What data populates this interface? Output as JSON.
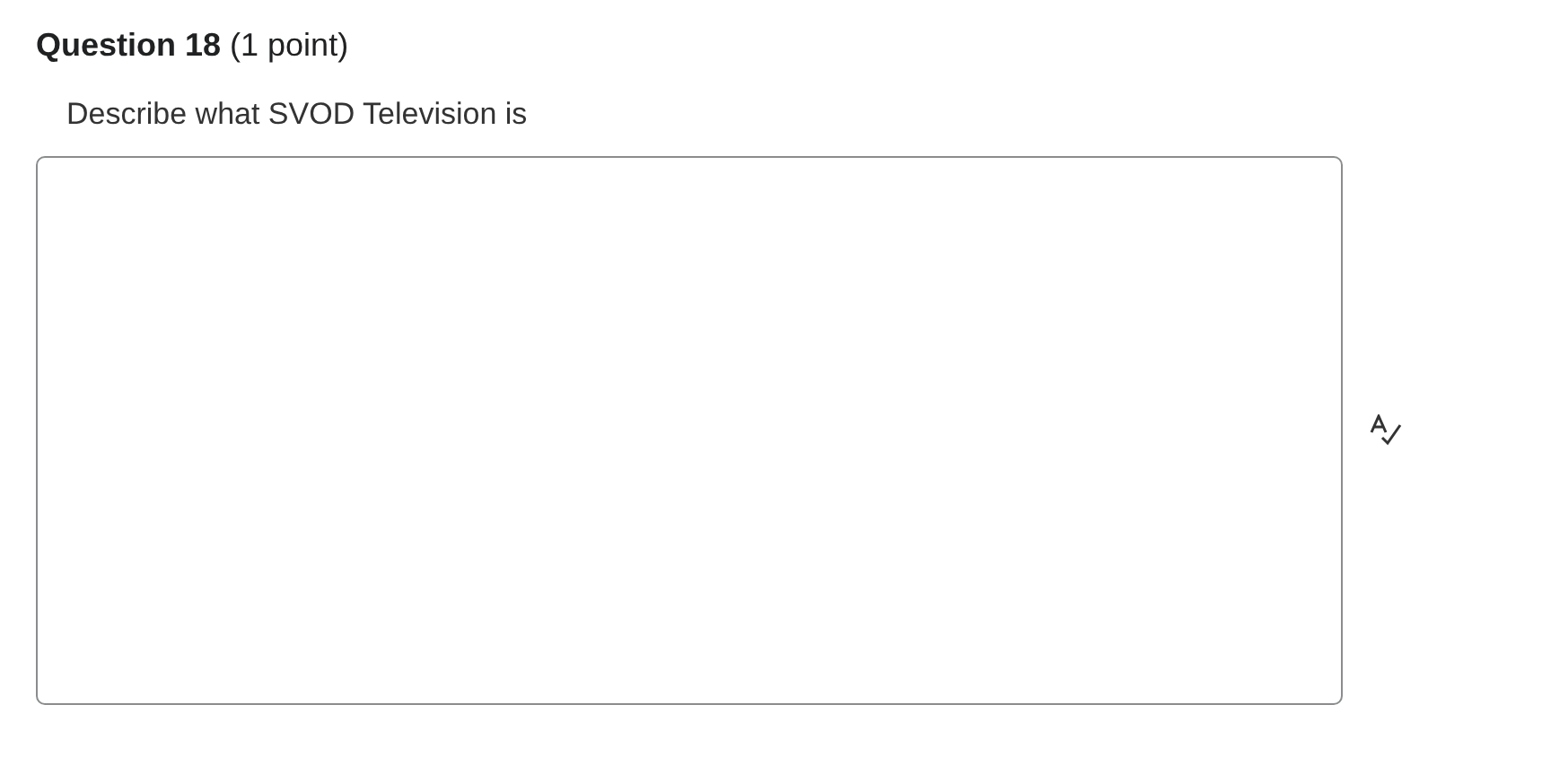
{
  "question": {
    "heading": "**Question 18** (1 point)",
    "prompt": "Describe what SVOD Television is"
  }
}
